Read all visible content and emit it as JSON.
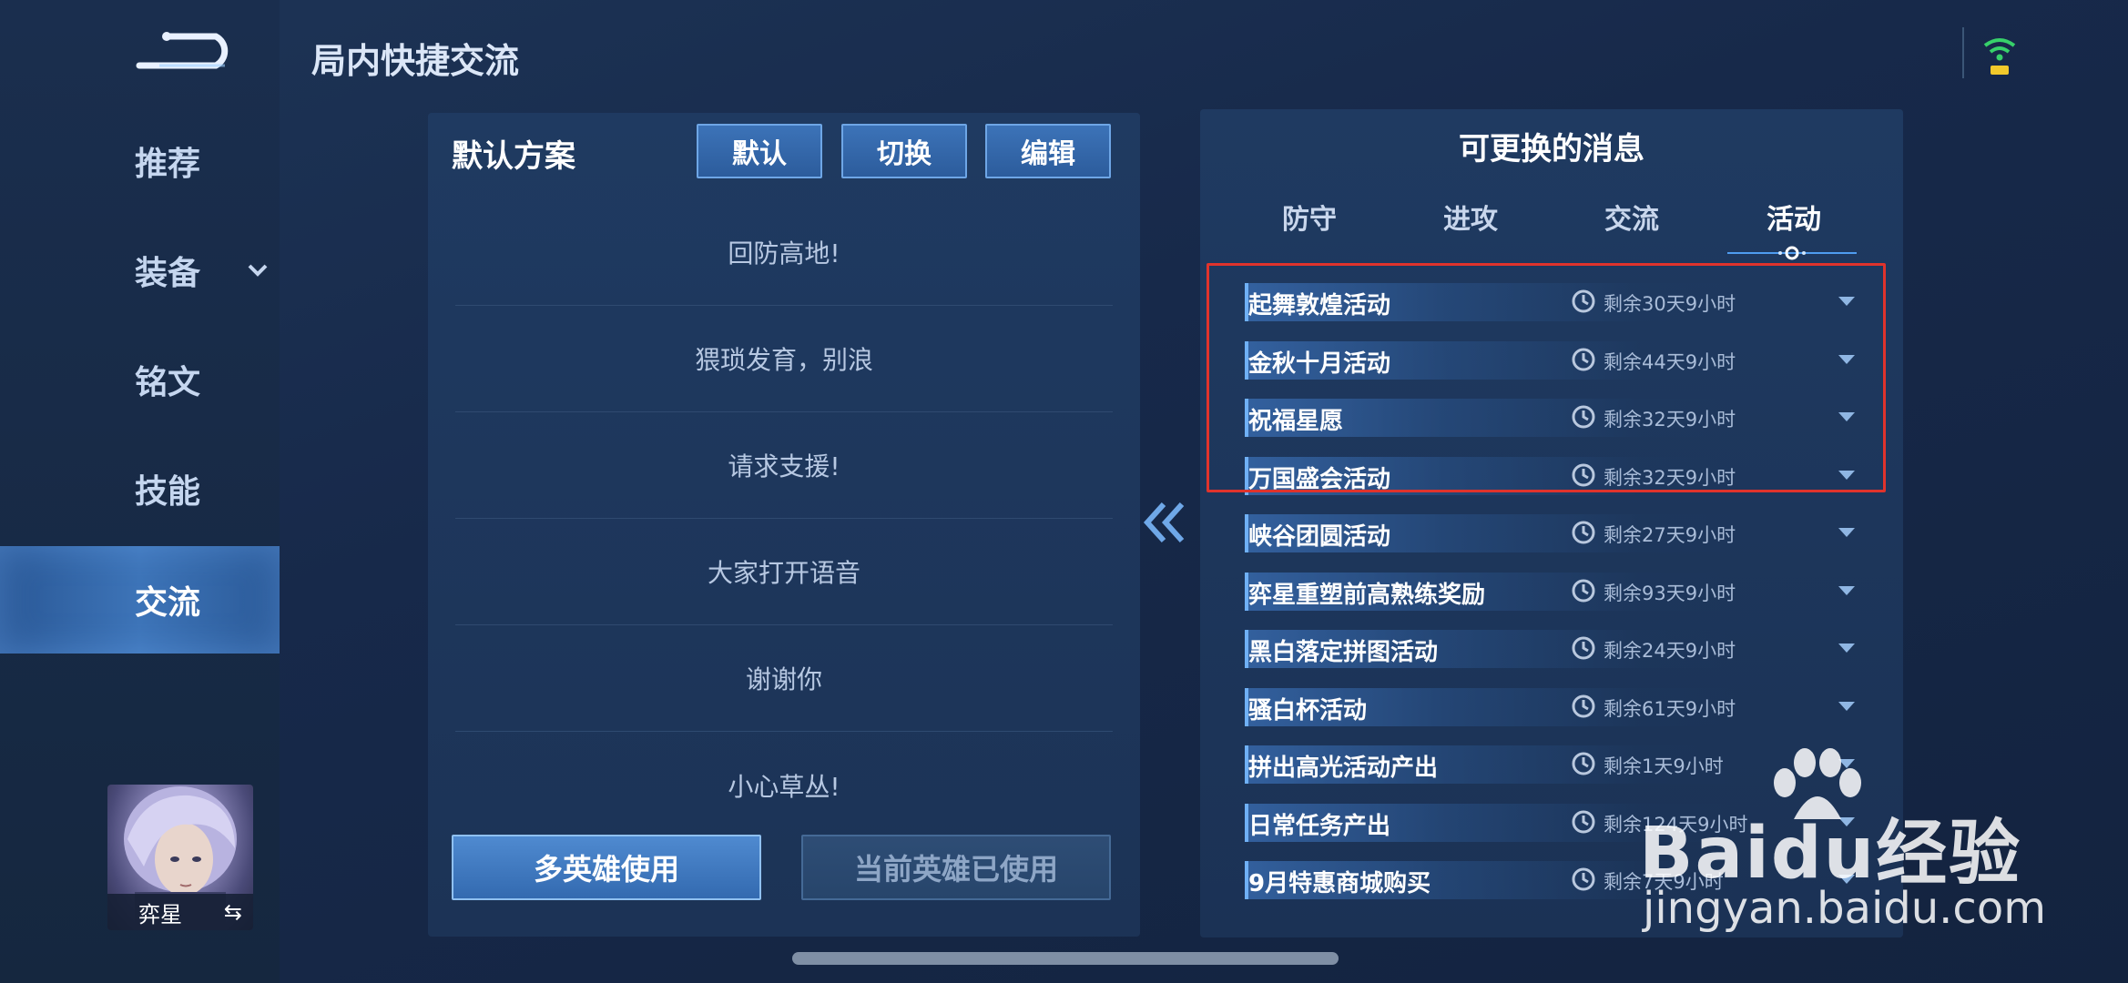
{
  "header": {
    "title": "局内快捷交流"
  },
  "sidebar": {
    "items": [
      {
        "label": "推荐"
      },
      {
        "label": "装备"
      },
      {
        "label": "铭文"
      },
      {
        "label": "技能"
      },
      {
        "label": "交流"
      }
    ],
    "hero": {
      "name": "弈星",
      "switch_symbol": "⇆"
    }
  },
  "left_panel": {
    "heading": "默认方案",
    "buttons": {
      "default": "默认",
      "switch": "切换",
      "edit": "编辑"
    },
    "messages": [
      "回防高地!",
      "猥琐发育，别浪",
      "请求支援!",
      "大家打开语音",
      "谢谢你",
      "小心草丛!"
    ],
    "multi_hero_button": "多英雄使用",
    "current_hero_button": "当前英雄已使用"
  },
  "right_panel": {
    "title": "可更换的消息",
    "tabs": [
      {
        "label": "防守"
      },
      {
        "label": "进攻"
      },
      {
        "label": "交流"
      },
      {
        "label": "活动"
      }
    ],
    "events": [
      {
        "name": "起舞敦煌活动",
        "time": "剩余30天9小时"
      },
      {
        "name": "金秋十月活动",
        "time": "剩余44天9小时"
      },
      {
        "name": "祝福星愿",
        "time": "剩余32天9小时"
      },
      {
        "name": "万国盛会活动",
        "time": "剩余32天9小时"
      },
      {
        "name": "峡谷团圆活动",
        "time": "剩余27天9小时"
      },
      {
        "name": "弈星重塑前高熟练奖励",
        "time": "剩余93天9小时"
      },
      {
        "name": "黑白落定拼图活动",
        "time": "剩余24天9小时"
      },
      {
        "name": "骚白杯活动",
        "time": "剩余61天9小时"
      },
      {
        "name": "拼出高光活动产出",
        "time": "剩余1天9小时"
      },
      {
        "name": "日常任务产出",
        "time": "剩余124天9小时"
      },
      {
        "name": "9月特惠商城购买",
        "time": "剩余7天9小时"
      }
    ]
  },
  "watermark": {
    "brand": "Baidu经验",
    "url": "jingyan.baidu.com"
  },
  "colors": {
    "accent": "#3d74b8",
    "highlight": "#e0332c",
    "background": "#17294a"
  }
}
